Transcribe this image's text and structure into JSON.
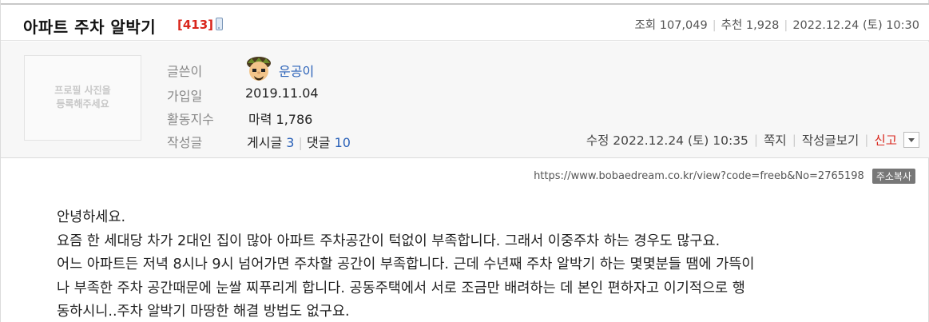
{
  "post": {
    "title": "아파트 주차 알박기",
    "comment_count": "[413]",
    "stats": {
      "views": "조회 107,049",
      "recommends": "추천 1,928",
      "date": "2022.12.24 (토) 10:30"
    }
  },
  "profile": {
    "photo_placeholder": "프로필 사진을\n등록해주세요",
    "labels": {
      "author": "글쓴이",
      "joined": "가입일",
      "activity": "활동지수",
      "posts": "작성글"
    },
    "author_name": "운공이",
    "joined_date": "2019.11.04",
    "activity_value": "마력 1,786",
    "posts_label": "게시글",
    "posts_count": "3",
    "comments_label": "댓글",
    "comments_count": "10"
  },
  "moderation": {
    "edited": "수정 2022.12.24 (토) 10:35",
    "message": "쪽지",
    "view_posts": "작성글보기",
    "report": "신고"
  },
  "url_bar": {
    "url": "https://www.bobaedream.co.kr/view?code=freeb&No=2765198",
    "copy_label": "주소복사"
  },
  "content": {
    "lines": [
      "안녕하세요.",
      "요즘 한 세대당 차가 2대인 집이 많아 아파트 주차공간이 턱없이 부족합니다. 그래서 이중주차 하는 경우도 많구요.",
      "어느 아파트든 저녁 8시나 9시 넘어가면 주차할 공간이 부족합니다. 근데 수년째 주차 알박기 하는 몇몇분들 땜에 가뜩이",
      "나  부족한 주차 공간때문에 눈쌀 찌푸리게 합니다. 공동주택에서 서로 조금만 배려하는 데 본인 편하자고 이기적으로 행",
      "동하시니..주차 알박기 마땅한 해결 방법도 없구요."
    ]
  },
  "colors": {
    "accent_red": "#d9261c",
    "link_blue": "#2a61b8",
    "panel_bg": "#f7f7f7"
  }
}
